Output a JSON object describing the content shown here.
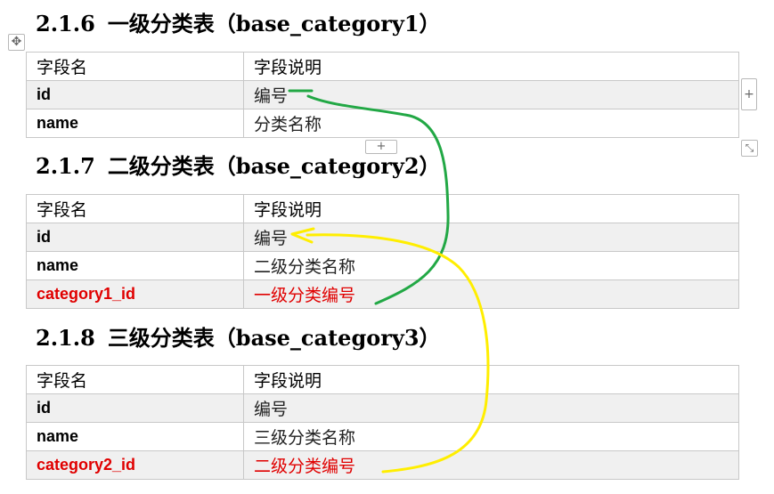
{
  "sections": [
    {
      "number": "2.1.6",
      "title": "一级分类表（base_category1）",
      "header": [
        "字段名",
        "字段说明"
      ],
      "rows": [
        {
          "field": "id",
          "desc": "编号",
          "highlight": false
        },
        {
          "field": "name",
          "desc": "分类名称",
          "highlight": false
        }
      ]
    },
    {
      "number": "2.1.7",
      "title": "二级分类表（base_category2）",
      "header": [
        "字段名",
        "字段说明"
      ],
      "rows": [
        {
          "field": "id",
          "desc": "编号",
          "highlight": false
        },
        {
          "field": "name",
          "desc": "二级分类名称",
          "highlight": false
        },
        {
          "field": "category1_id",
          "desc": "一级分类编号",
          "highlight": true
        }
      ]
    },
    {
      "number": "2.1.8",
      "title": "三级分类表（base_category3）",
      "header": [
        "字段名",
        "字段说明"
      ],
      "rows": [
        {
          "field": "id",
          "desc": "编号",
          "highlight": false
        },
        {
          "field": "name",
          "desc": "三级分类名称",
          "highlight": false
        },
        {
          "field": "category2_id",
          "desc": "二级分类编号",
          "highlight": true
        }
      ]
    }
  ],
  "colors": {
    "highlight_text": "#e00000",
    "arrow_green": "#22a845",
    "arrow_yellow": "#ffee00",
    "row_shade": "#f0f0f0",
    "border": "#c8c8c8"
  },
  "controls": {
    "table_move_icon": "move-cross-icon",
    "add_row_icon": "plus-icon",
    "add_column_icon": "plus-icon",
    "resize_icon": "resize-diagonal-icon"
  },
  "glyphs": {
    "move": "✥",
    "plus": "+",
    "resize": "⤡"
  }
}
